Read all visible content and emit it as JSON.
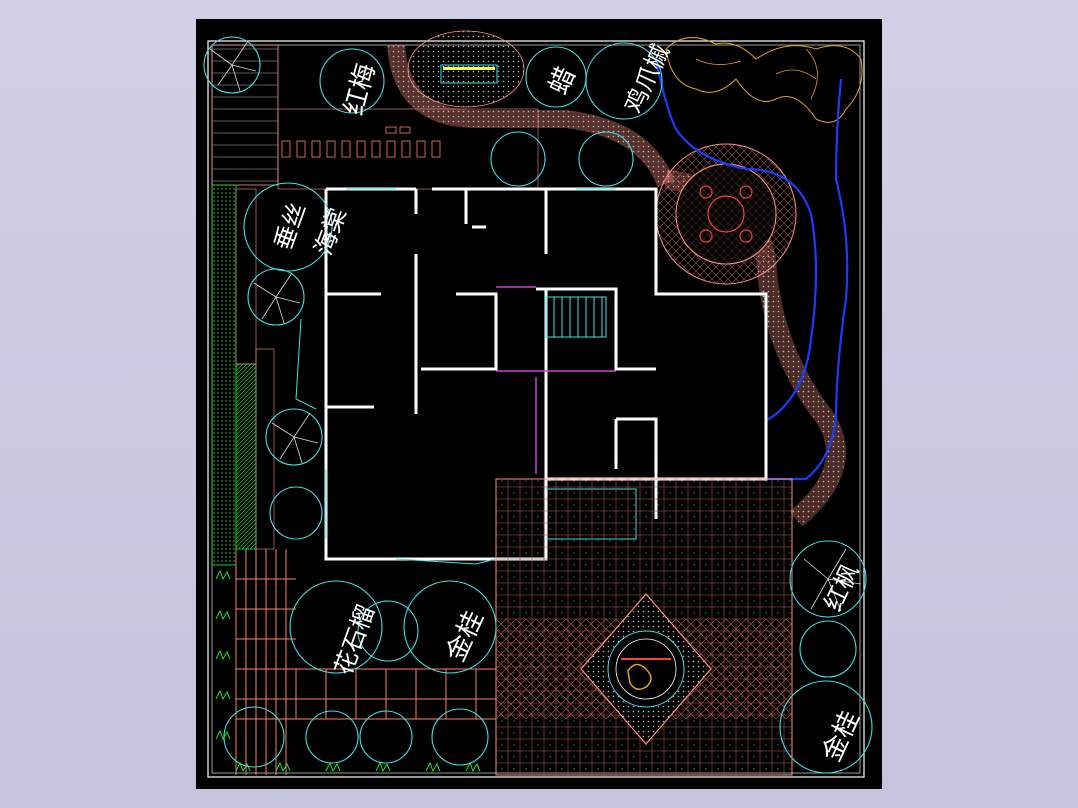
{
  "viewport_background": "#c8c8e0",
  "canvas_background": "#000000",
  "colors": {
    "boundary": "#ffffff",
    "paving": "#f0a080",
    "tree_outline": "#40e0e8",
    "stream": "#1a3cff",
    "rockery": "#e0a020",
    "hedge": "#20e020",
    "stair": "#40e0e8",
    "wall": "#ffffff",
    "accent": "#d040d0"
  },
  "plant_labels": [
    {
      "id": "hongmei",
      "text": "红梅"
    },
    {
      "id": "laxi",
      "text": "蜡"
    },
    {
      "id": "jizhuaqi",
      "text": "鸡爪槭"
    },
    {
      "id": "chuisi",
      "text": "垂丝"
    },
    {
      "id": "haitang",
      "text": "海棠"
    },
    {
      "id": "huashiliu",
      "text": "花石榴"
    },
    {
      "id": "jingui1",
      "text": "金桂"
    },
    {
      "id": "hongfeng",
      "text": "红枫"
    },
    {
      "id": "jingui2",
      "text": "金桂"
    }
  ]
}
